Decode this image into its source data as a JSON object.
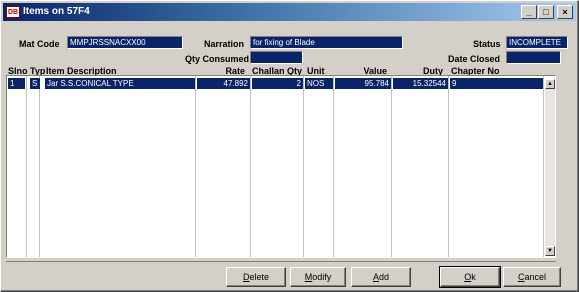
{
  "window": {
    "title": "Items on 57F4",
    "controls": [
      "_",
      "□",
      "×"
    ]
  },
  "form": {
    "mat_code_label": "Mat Code",
    "mat_code_value": "MMPJRSSNACXX00",
    "narration_label": "Narration",
    "narration_value": "for fixing of Blade",
    "status_label": "Status",
    "status_value": "INCOMPLETE",
    "qty_consumed_label": "Qty Consumed",
    "qty_consumed_value": "",
    "date_closed_label": "Date Closed",
    "date_closed_value": ""
  },
  "grid": {
    "headers": {
      "slno": "Slno",
      "typ": "Typ",
      "item_description": "Item Description",
      "rate": "Rate",
      "challan_qty": "Challan Qty",
      "unit": "Unit",
      "value": "Value",
      "duty": "Duty",
      "chapter_no": "Chapter No"
    },
    "rows": [
      {
        "slno": "1",
        "typ": "S",
        "item_description": "Jar S.S.CONICAL TYPE",
        "rate": "47.892",
        "challan_qty": "2",
        "unit": "NOS",
        "value": "95.784",
        "duty": "15.32544",
        "chapter_no": "9"
      }
    ]
  },
  "buttons": {
    "delete": {
      "underlined": "D",
      "rest": "elete"
    },
    "modify": {
      "underlined": "M",
      "rest": "odify"
    },
    "add": {
      "underlined": "A",
      "rest": "dd"
    },
    "ok": {
      "underlined": "O",
      "rest": "k"
    },
    "cancel": {
      "underlined": "C",
      "rest": "ancel"
    }
  },
  "colors": {
    "selection": "#0a246a",
    "face": "#d4d0c8"
  }
}
